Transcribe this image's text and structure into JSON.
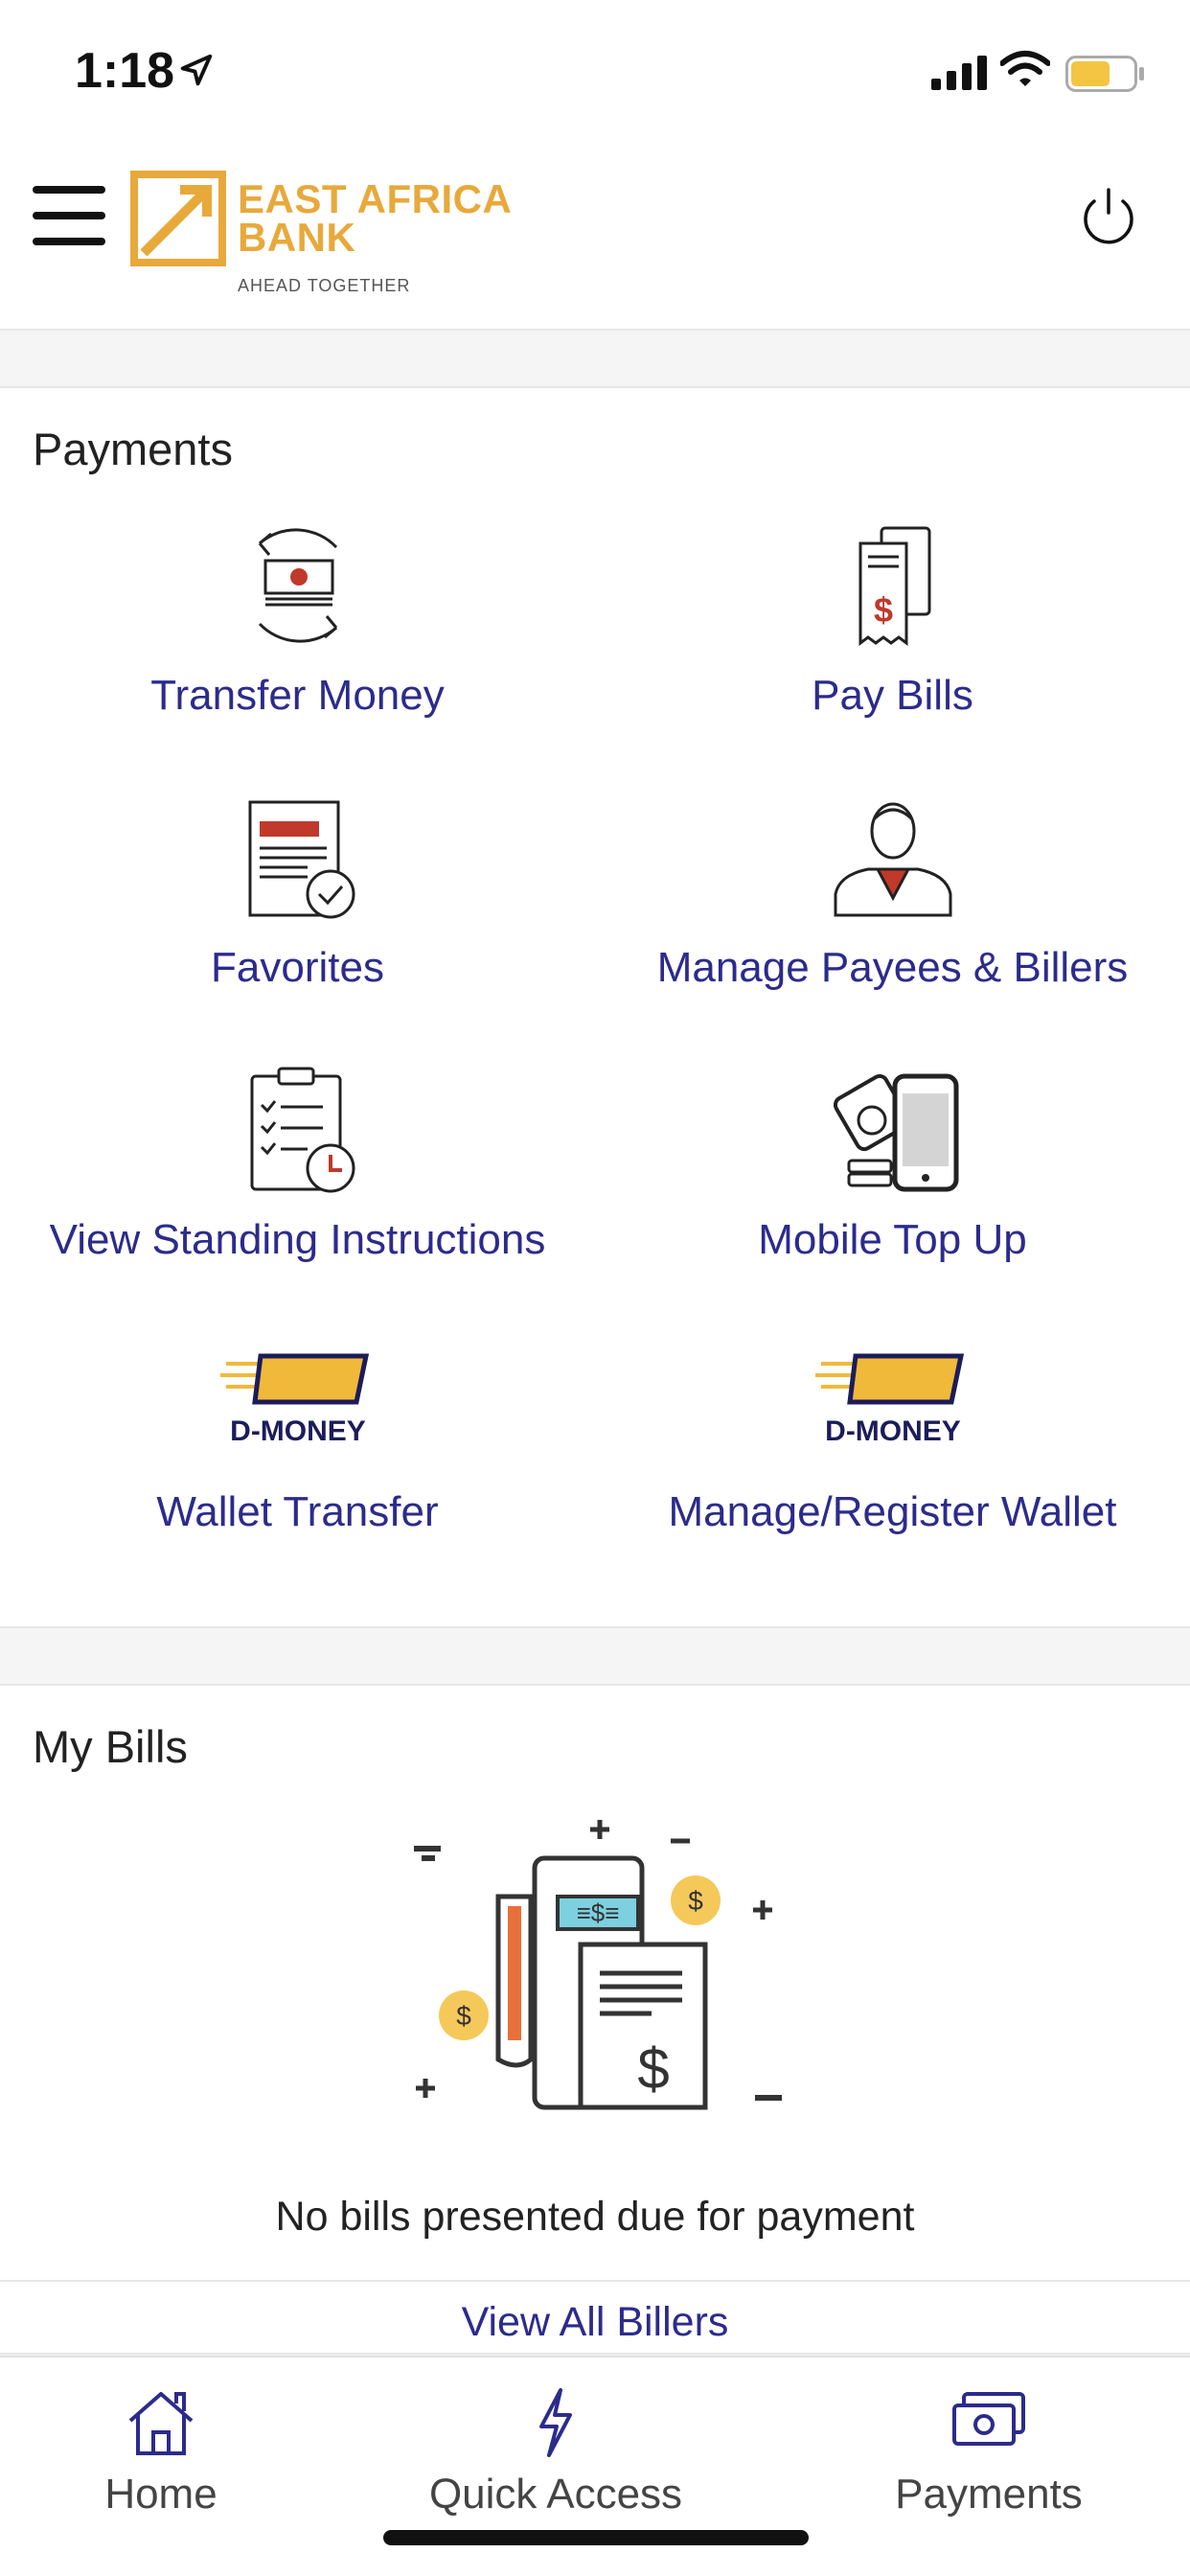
{
  "status_bar": {
    "time": "1:18",
    "icons": [
      "location-arrow-icon",
      "signal-icon",
      "wifi-icon",
      "battery-icon"
    ]
  },
  "header": {
    "logo_line1": "EAST AFRICA",
    "logo_line2": "BANK",
    "logo_tagline": "AHEAD TOGETHER",
    "brand_color": "#e8a93b"
  },
  "payments": {
    "title": "Payments",
    "items": [
      {
        "label": "Transfer Money",
        "icon": "transfer-money-icon"
      },
      {
        "label": "Pay Bills",
        "icon": "pay-bills-icon"
      },
      {
        "label": "Favorites",
        "icon": "favorites-icon"
      },
      {
        "label": "Manage Payees & Billers",
        "icon": "payee-person-icon"
      },
      {
        "label": "View Standing Instructions",
        "icon": "clipboard-clock-icon"
      },
      {
        "label": "Mobile Top Up",
        "icon": "mobile-topup-icon"
      },
      {
        "label": "Wallet Transfer",
        "icon": "d-money-icon",
        "badge": "D-MONEY"
      },
      {
        "label": "Manage/Register Wallet",
        "icon": "d-money-icon",
        "badge": "D-MONEY"
      }
    ]
  },
  "my_bills": {
    "title": "My Bills",
    "empty_message": "No bills presented due for payment",
    "view_all": "View All Billers"
  },
  "tabs": [
    {
      "label": "Home",
      "icon": "home-icon"
    },
    {
      "label": "Quick Access",
      "icon": "lightning-icon"
    },
    {
      "label": "Payments",
      "icon": "payments-cash-icon"
    }
  ],
  "colors": {
    "link": "#2c2b8c",
    "accent": "#e8a93b",
    "alert": "#c0392b"
  }
}
